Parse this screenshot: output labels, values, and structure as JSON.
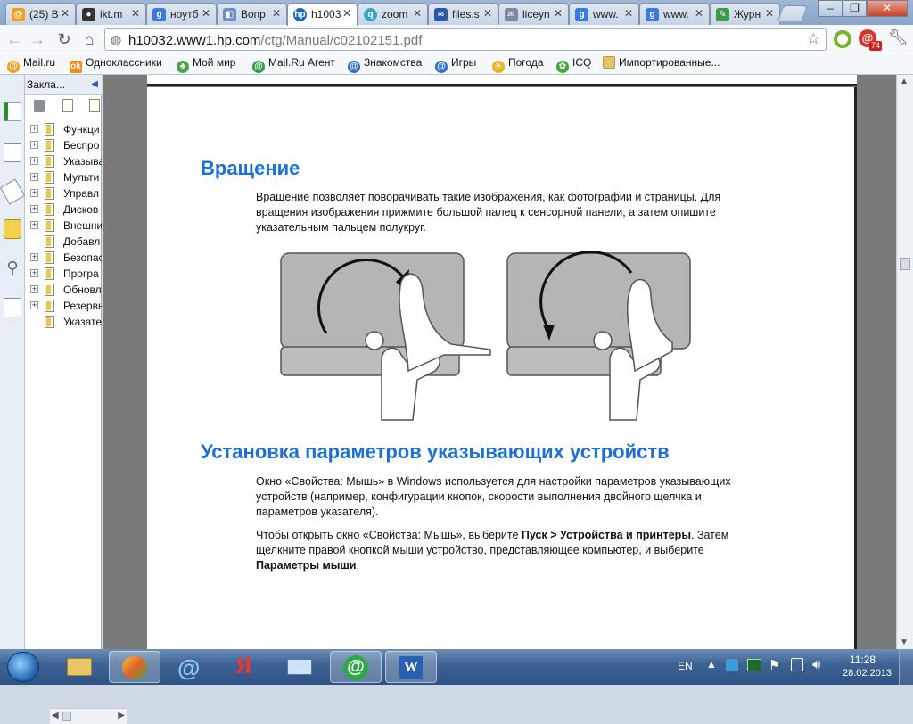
{
  "tabs": [
    {
      "label": "(25) В",
      "icon": "mailru-icon",
      "active": false
    },
    {
      "label": "ikt.m",
      "icon": "panda-icon",
      "active": false
    },
    {
      "label": "ноутб",
      "icon": "google-icon",
      "active": false
    },
    {
      "label": "Вопр",
      "icon": "page-icon",
      "active": false
    },
    {
      "label": "h1003",
      "icon": "hp-icon",
      "active": true
    },
    {
      "label": "zoom",
      "icon": "zoom-icon",
      "active": false
    },
    {
      "label": "files.s",
      "icon": "files-icon",
      "active": false
    },
    {
      "label": "liceyn",
      "icon": "licey-icon",
      "active": false
    },
    {
      "label": "www.",
      "icon": "google-icon",
      "active": false
    },
    {
      "label": "www.",
      "icon": "google-icon",
      "active": false
    },
    {
      "label": "Журн",
      "icon": "journal-icon",
      "active": false
    }
  ],
  "address": {
    "host": "h10032.www1.hp.com",
    "path": "/ctg/Manual/c02102151.pdf"
  },
  "extension_badge": "74",
  "bookmarks": [
    {
      "label": "Mail.ru",
      "icon": "mailru-icon"
    },
    {
      "label": "Одноклассники",
      "icon": "odnoklassniki-icon"
    },
    {
      "label": "Мой мир",
      "icon": "moymir-icon"
    },
    {
      "label": "Mail.Ru Агент",
      "icon": "agent-icon"
    },
    {
      "label": "Знакомства",
      "icon": "dating-icon"
    },
    {
      "label": "Игры",
      "icon": "games-icon"
    },
    {
      "label": "Погода",
      "icon": "weather-icon"
    },
    {
      "label": "ICQ",
      "icon": "icq-icon"
    },
    {
      "label": "Импортированные...",
      "icon": "folder-icon"
    }
  ],
  "sidebar": {
    "title": "Закла...",
    "items": [
      {
        "label": "Функци",
        "expandable": true
      },
      {
        "label": "Беспро",
        "expandable": true
      },
      {
        "label": "Указыва",
        "expandable": true
      },
      {
        "label": "Мульти",
        "expandable": true
      },
      {
        "label": "Управл",
        "expandable": true
      },
      {
        "label": "Дисков",
        "expandable": true
      },
      {
        "label": "Внешни",
        "expandable": true
      },
      {
        "label": "Добавл",
        "expandable": false
      },
      {
        "label": "Безопас",
        "expandable": true
      },
      {
        "label": "Програ",
        "expandable": true
      },
      {
        "label": "Обновл",
        "expandable": true
      },
      {
        "label": "Резервн",
        "expandable": true
      },
      {
        "label": "Указате",
        "expandable": false
      }
    ]
  },
  "document": {
    "section1_title": "Вращение",
    "section1_text_line1": "Вращение позволяет поворачивать такие изображения, как фотографии и страницы. Для",
    "section1_text_line2": "вращения изображения прижмите большой палец к сенсорной панели, а затем опишите",
    "section1_text_line3": "указательным пальцем полукруг.",
    "section2_title": "Установка параметров указывающих устройств",
    "section2_p1_line1": "Окно «Свойства: Мышь» в Windows используется для настройки параметров указывающих",
    "section2_p1_line2": "устройств (например, конфигурации кнопок, скорости выполнения двойного щелчка и",
    "section2_p1_line3": "параметров указателя).",
    "section2_p2_line1_a": "Чтобы открыть окно «Свойства: Мышь», выберите ",
    "section2_p2_line1_b": "Пуск > Устройства и принтеры",
    "section2_p2_line1_c": ". Затем",
    "section2_p2_line2": "щелкните правой кнопкой мыши устройство, представляющее компьютер, и выберите",
    "section2_p2_line3_b": "Параметры мыши",
    "section2_p2_line3_c": "."
  },
  "taskbar": {
    "language": "EN",
    "time": "11:28",
    "date": "28.02.2013",
    "apps": [
      "explorer-icon",
      "chrome-icon",
      "ie-icon",
      "yandex-icon",
      "mail-icon",
      "mailru-agent-icon",
      "word-icon"
    ]
  },
  "colors": {
    "heading": "#1a6fd8",
    "taskbar": "#2e5284"
  }
}
